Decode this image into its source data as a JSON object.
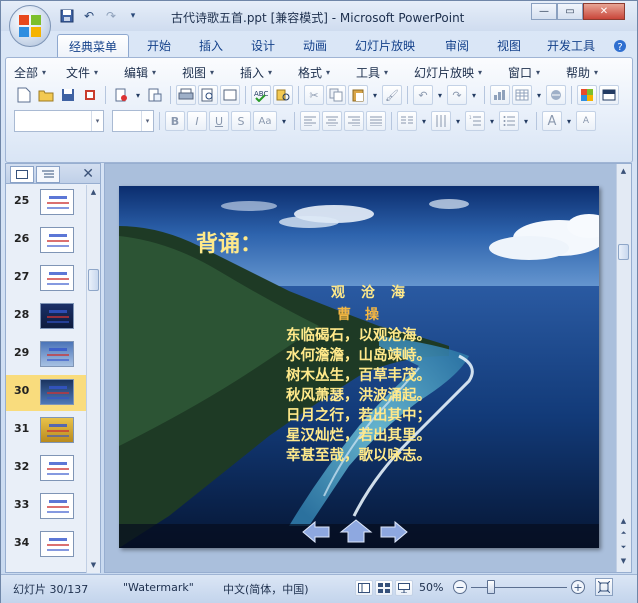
{
  "window": {
    "title": "古代诗歌五首.ppt [兼容模式] - Microsoft PowerPoint"
  },
  "icons": {
    "save": "save-icon",
    "undo": "undo-icon",
    "redo": "redo-icon",
    "customize": "dropdown-icon"
  },
  "tabs": [
    "经典菜单",
    "开始",
    "插入",
    "设计",
    "动画",
    "幻灯片放映",
    "审阅",
    "视图",
    "开发工具"
  ],
  "menus": [
    "全部",
    "文件",
    "编辑",
    "视图",
    "插入",
    "格式",
    "工具",
    "幻灯片放映",
    "窗口",
    "帮助"
  ],
  "format_buttons": {
    "bold": "B",
    "italic": "I",
    "underline": "U",
    "strike": "S",
    "case": "Aa",
    "font_grow": "A",
    "font_shrink": "A"
  },
  "slides": [
    {
      "number": "25"
    },
    {
      "number": "26"
    },
    {
      "number": "27"
    },
    {
      "number": "28"
    },
    {
      "number": "29"
    },
    {
      "number": "30"
    },
    {
      "number": "31"
    },
    {
      "number": "32"
    },
    {
      "number": "33"
    },
    {
      "number": "34"
    }
  ],
  "slide": {
    "heading": "背诵：",
    "poem_title": "观沧海",
    "poem_author": "曹操",
    "lines": [
      "东临碣石，以观沧海。",
      "水何澹澹，山岛竦峙。",
      "树木丛生，百草丰茂。",
      "秋风萧瑟，洪波涌起。",
      "日月之行，若出其中；",
      "星汉灿烂，若出其里。",
      "幸甚至哉，歌以咏志。"
    ]
  },
  "status": {
    "slide_info": "幻灯片 30/137",
    "theme": "\"Watermark\"",
    "language": "中文(简体，中国)",
    "zoom": "50%"
  },
  "colors": {
    "poem_text": "#ffe98a",
    "author_text": "#f4b642",
    "selected_slide": "#f9dc7d"
  }
}
